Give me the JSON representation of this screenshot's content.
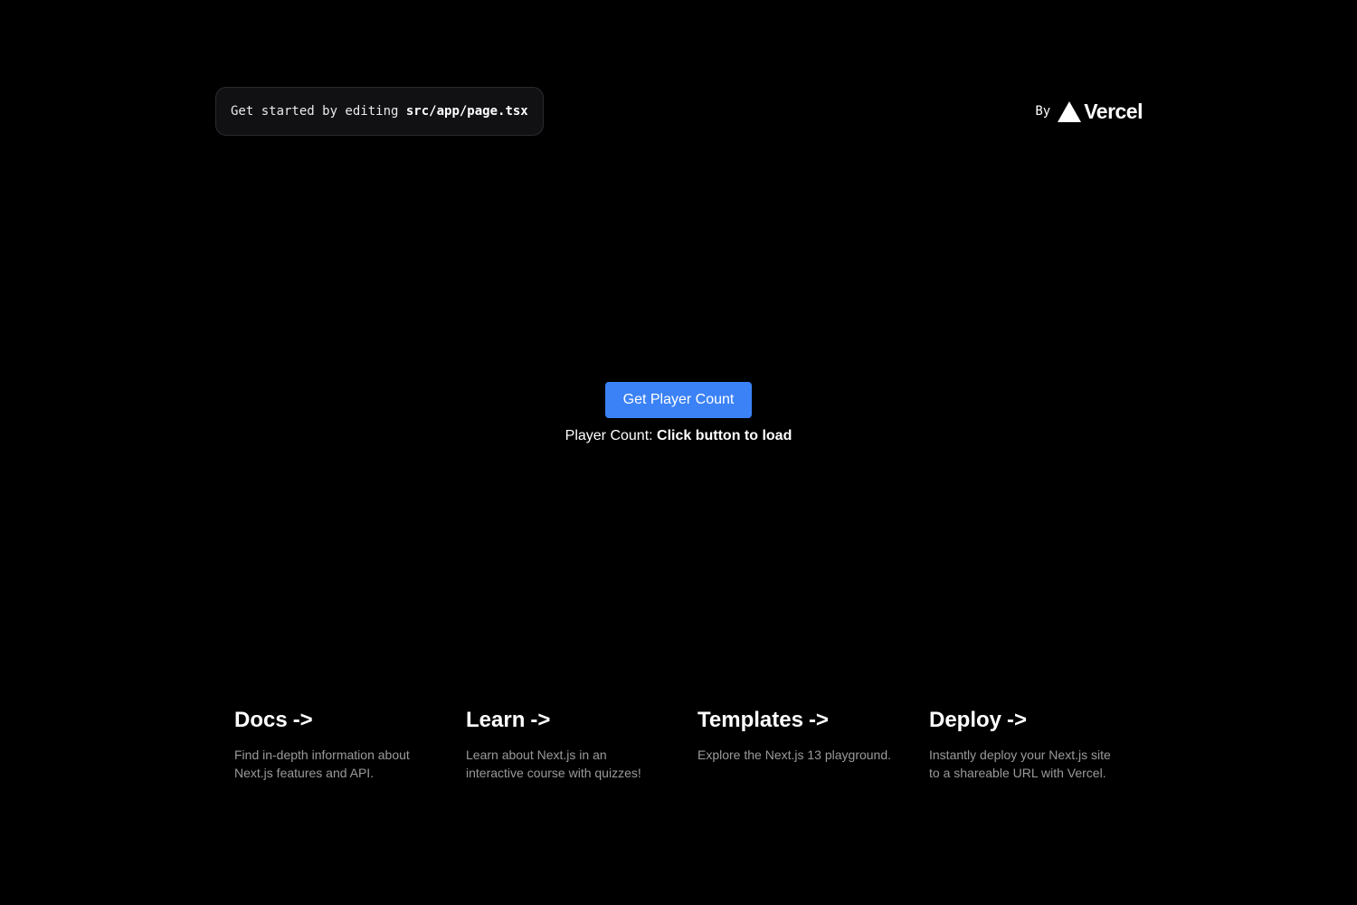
{
  "header": {
    "get_started_text": "Get started by editing",
    "file_path": "src/app/page.tsx",
    "by_label": "By",
    "vercel_logo_text": "Vercel"
  },
  "main": {
    "button_label": "Get Player Count",
    "count_label": "Player Count:",
    "count_value": "Click button to load"
  },
  "cards": [
    {
      "title": "Docs",
      "arrow": "->",
      "description": "Find in-depth information about Next.js features and API."
    },
    {
      "title": "Learn",
      "arrow": "->",
      "description": "Learn about Next.js in an interactive course with quizzes!"
    },
    {
      "title": "Templates",
      "arrow": "->",
      "description": "Explore the Next.js 13 playground."
    },
    {
      "title": "Deploy",
      "arrow": "->",
      "description": "Instantly deploy your Next.js site to a shareable URL with Vercel."
    }
  ],
  "colors": {
    "background": "#000000",
    "button": "#3b82f6",
    "muted_text": "#9a9a9a"
  }
}
